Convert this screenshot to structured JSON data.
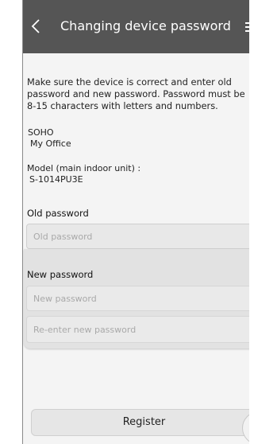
{
  "header": {
    "back_icon": "chevron-left-icon",
    "title": "Changing device password",
    "menu_icon": "menu-icon"
  },
  "intro": "Make sure the device is correct and enter old password and new password. Password must be 8-15 characters with letters and numbers.",
  "site": {
    "name": "SOHO",
    "location": "My Office"
  },
  "model": {
    "label": "Model (main indoor unit) :",
    "value": "S-1014PU3E"
  },
  "old_password": {
    "label": "Old password",
    "placeholder": "Old password"
  },
  "new_password": {
    "label": "New password",
    "placeholder": "New password",
    "reenter_placeholder": "Re-enter new password"
  },
  "register_label": "Register",
  "colors": {
    "header": "#555555",
    "background": "#f4f4f4",
    "field": "#e8e8e8"
  }
}
